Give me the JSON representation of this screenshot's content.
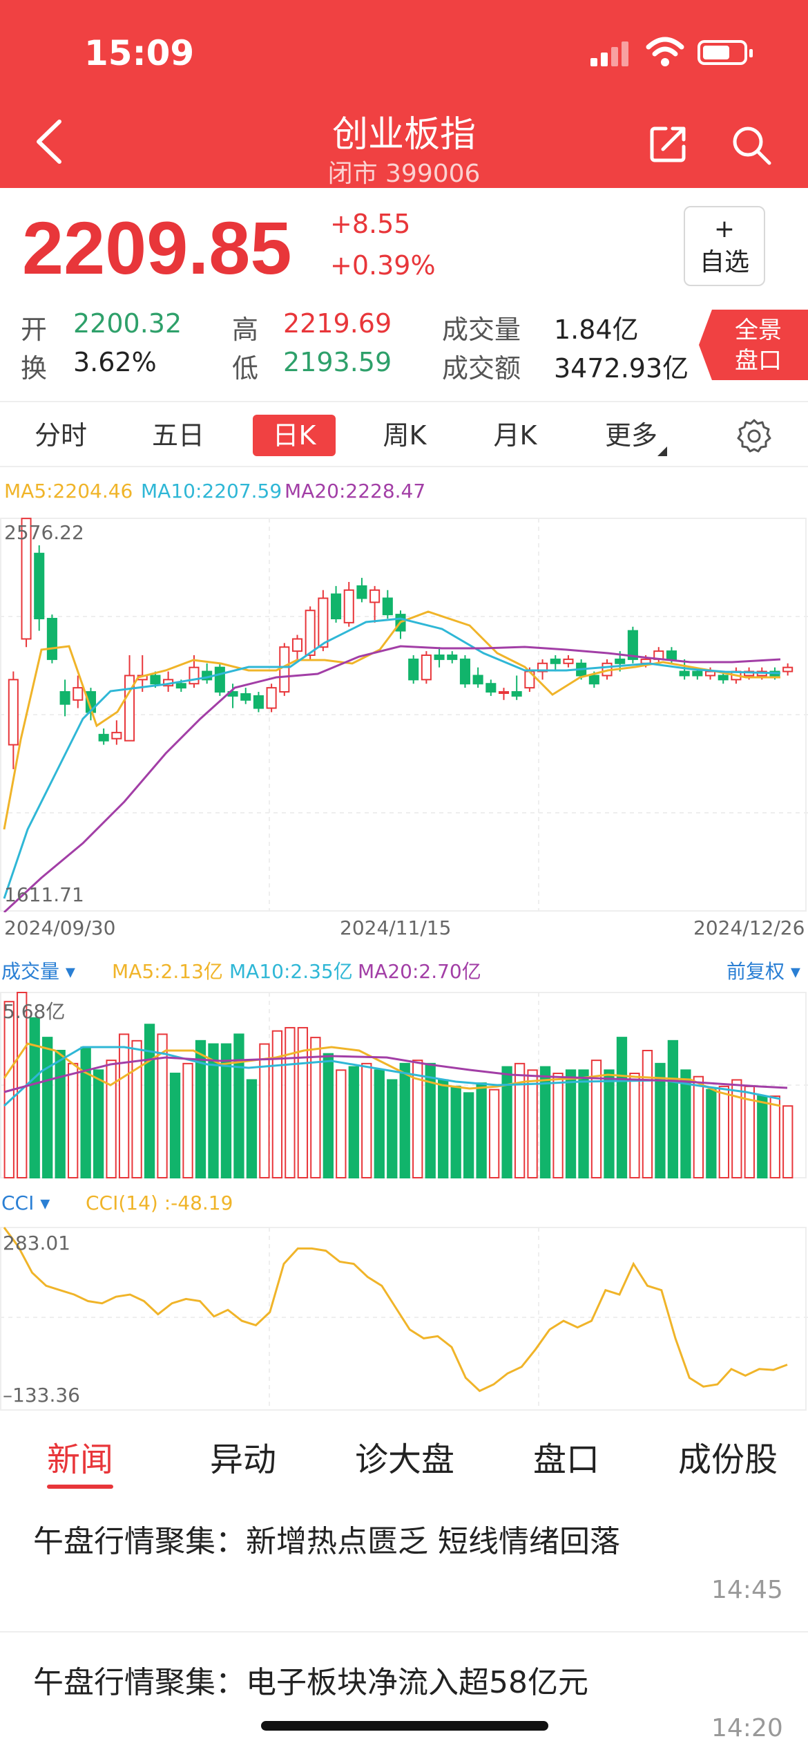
{
  "status_bar": {
    "time": "15:09"
  },
  "header": {
    "title": "创业板指",
    "subtitle": "闭市 399006"
  },
  "quote": {
    "price": "2209.85",
    "change": "+8.55",
    "change_pct": "+0.39%",
    "watch_plus": "+",
    "watch_label": "自选",
    "open_label": "开",
    "open": "2200.32",
    "high_label": "高",
    "high": "2219.69",
    "volume_label": "成交量",
    "volume": "1.84亿",
    "turnover_label": "换",
    "turnover": "3.62%",
    "low_label": "低",
    "low": "2193.59",
    "amount_label": "成交额",
    "amount": "3472.93亿",
    "panorama_line1": "全景",
    "panorama_line2": "盘口"
  },
  "period_tabs": [
    {
      "label": "分时",
      "active": false
    },
    {
      "label": "五日",
      "active": false
    },
    {
      "label": "日K",
      "active": true
    },
    {
      "label": "周K",
      "active": false
    },
    {
      "label": "月K",
      "active": false
    },
    {
      "label": "更多",
      "active": false
    }
  ],
  "kline": {
    "ma5": "MA5:2204.46",
    "ma10": "MA10:2207.59",
    "ma20": "MA20:2228.47",
    "y_max_label": "2576.22",
    "y_min_label": "1611.71",
    "date_start": "2024/09/30",
    "date_mid": "2024/11/15",
    "date_end": "2024/12/26"
  },
  "volume": {
    "title": "成交量",
    "ma5": "MA5:2.13亿",
    "ma10": "MA10:2.35亿",
    "ma20": "MA20:2.70亿",
    "adjust": "前复权",
    "max_label": "5.68亿"
  },
  "cci": {
    "title": "CCI",
    "value": "CCI(14)  :-48.19",
    "max_label": "283.01",
    "min_label": "–133.36"
  },
  "colors": {
    "up": "#e8363a",
    "down": "#11b46b",
    "ma5": "#f0b429",
    "ma10": "#2fb7d6",
    "ma20": "#a23ea6",
    "brand": "#f04142"
  },
  "bottom_tabs": [
    {
      "label": "新闻",
      "active": true
    },
    {
      "label": "异动",
      "active": false
    },
    {
      "label": "诊大盘",
      "active": false
    },
    {
      "label": "盘口",
      "active": false
    },
    {
      "label": "成份股",
      "active": false
    }
  ],
  "news": [
    {
      "title": "午盘行情聚集：新增热点匮乏 短线情绪回落",
      "time": "14:45"
    },
    {
      "title": "午盘行情聚集：电子板块净流入超58亿元",
      "time": "14:20"
    }
  ],
  "chart_data": [
    {
      "type": "candlestick",
      "title": "",
      "ylim": [
        1611.71,
        2576.22
      ],
      "x": [
        "2024/09/30",
        "2024/11/15",
        "2024/12/26"
      ],
      "candles": [
        {
          "o": 2020,
          "c": 2180,
          "h": 2200,
          "l": 1960
        },
        {
          "o": 2280,
          "c": 2576,
          "h": 2576,
          "l": 2260
        },
        {
          "o": 2490,
          "c": 2330,
          "h": 2510,
          "l": 2300
        },
        {
          "o": 2330,
          "c": 2230,
          "h": 2340,
          "l": 2220
        },
        {
          "o": 2150,
          "c": 2120,
          "h": 2180,
          "l": 2090
        },
        {
          "o": 2130,
          "c": 2160,
          "h": 2190,
          "l": 2110
        },
        {
          "o": 2150,
          "c": 2100,
          "h": 2160,
          "l": 2080
        },
        {
          "o": 2045,
          "c": 2030,
          "h": 2060,
          "l": 2020
        },
        {
          "o": 2035,
          "c": 2050,
          "h": 2080,
          "l": 2020
        },
        {
          "o": 2030,
          "c": 2190,
          "h": 2240,
          "l": 2030
        },
        {
          "o": 2180,
          "c": 2190,
          "h": 2240,
          "l": 2150
        },
        {
          "o": 2190,
          "c": 2170,
          "h": 2200,
          "l": 2160
        },
        {
          "o": 2165,
          "c": 2180,
          "h": 2200,
          "l": 2150
        },
        {
          "o": 2170,
          "c": 2160,
          "h": 2180,
          "l": 2150
        },
        {
          "o": 2170,
          "c": 2210,
          "h": 2240,
          "l": 2160
        },
        {
          "o": 2200,
          "c": 2180,
          "h": 2220,
          "l": 2170
        },
        {
          "o": 2210,
          "c": 2150,
          "h": 2220,
          "l": 2140
        },
        {
          "o": 2150,
          "c": 2140,
          "h": 2170,
          "l": 2110
        },
        {
          "o": 2145,
          "c": 2130,
          "h": 2160,
          "l": 2120
        },
        {
          "o": 2140,
          "c": 2110,
          "h": 2150,
          "l": 2100
        },
        {
          "o": 2110,
          "c": 2160,
          "h": 2170,
          "l": 2100
        },
        {
          "o": 2150,
          "c": 2260,
          "h": 2270,
          "l": 2140
        },
        {
          "o": 2250,
          "c": 2280,
          "h": 2290,
          "l": 2230
        },
        {
          "o": 2240,
          "c": 2350,
          "h": 2360,
          "l": 2230
        },
        {
          "o": 2260,
          "c": 2380,
          "h": 2400,
          "l": 2250
        },
        {
          "o": 2390,
          "c": 2330,
          "h": 2410,
          "l": 2320
        },
        {
          "o": 2320,
          "c": 2400,
          "h": 2420,
          "l": 2310
        },
        {
          "o": 2410,
          "c": 2380,
          "h": 2430,
          "l": 2370
        },
        {
          "o": 2370,
          "c": 2400,
          "h": 2410,
          "l": 2320
        },
        {
          "o": 2380,
          "c": 2340,
          "h": 2400,
          "l": 2330
        },
        {
          "o": 2340,
          "c": 2300,
          "h": 2350,
          "l": 2280
        },
        {
          "o": 2230,
          "c": 2180,
          "h": 2240,
          "l": 2170
        },
        {
          "o": 2180,
          "c": 2240,
          "h": 2250,
          "l": 2170
        },
        {
          "o": 2240,
          "c": 2230,
          "h": 2260,
          "l": 2210
        },
        {
          "o": 2240,
          "c": 2230,
          "h": 2250,
          "l": 2220
        },
        {
          "o": 2230,
          "c": 2170,
          "h": 2240,
          "l": 2160
        },
        {
          "o": 2190,
          "c": 2170,
          "h": 2210,
          "l": 2160
        },
        {
          "o": 2170,
          "c": 2150,
          "h": 2180,
          "l": 2140
        },
        {
          "o": 2150,
          "c": 2150,
          "h": 2160,
          "l": 2130
        },
        {
          "o": 2150,
          "c": 2140,
          "h": 2190,
          "l": 2130
        },
        {
          "o": 2160,
          "c": 2200,
          "h": 2210,
          "l": 2150
        },
        {
          "o": 2200,
          "c": 2220,
          "h": 2230,
          "l": 2180
        },
        {
          "o": 2230,
          "c": 2220,
          "h": 2240,
          "l": 2200
        },
        {
          "o": 2220,
          "c": 2230,
          "h": 2240,
          "l": 2210
        },
        {
          "o": 2220,
          "c": 2190,
          "h": 2230,
          "l": 2180
        },
        {
          "o": 2190,
          "c": 2170,
          "h": 2200,
          "l": 2160
        },
        {
          "o": 2190,
          "c": 2220,
          "h": 2230,
          "l": 2180
        },
        {
          "o": 2230,
          "c": 2220,
          "h": 2250,
          "l": 2200
        },
        {
          "o": 2300,
          "c": 2230,
          "h": 2310,
          "l": 2220
        },
        {
          "o": 2220,
          "c": 2230,
          "h": 2240,
          "l": 2210
        },
        {
          "o": 2230,
          "c": 2250,
          "h": 2260,
          "l": 2220
        },
        {
          "o": 2250,
          "c": 2230,
          "h": 2260,
          "l": 2220
        },
        {
          "o": 2200,
          "c": 2190,
          "h": 2230,
          "l": 2180
        },
        {
          "o": 2200,
          "c": 2190,
          "h": 2210,
          "l": 2180
        },
        {
          "o": 2190,
          "c": 2200,
          "h": 2210,
          "l": 2180
        },
        {
          "o": 2190,
          "c": 2180,
          "h": 2200,
          "l": 2170
        },
        {
          "o": 2180,
          "c": 2200,
          "h": 2210,
          "l": 2170
        },
        {
          "o": 2190,
          "c": 2200,
          "h": 2210,
          "l": 2180
        },
        {
          "o": 2190,
          "c": 2200,
          "h": 2210,
          "l": 2180
        },
        {
          "o": 2200,
          "c": 2190,
          "h": 2210,
          "l": 2180
        },
        {
          "o": 2200,
          "c": 2210,
          "h": 2220,
          "l": 2190
        }
      ]
    },
    {
      "type": "bar",
      "title": "",
      "ylim": [
        0,
        5.68
      ],
      "values": [
        5.4,
        5.68,
        4.9,
        4.3,
        3.9,
        3.5,
        4.0,
        3.3,
        3.6,
        4.4,
        4.2,
        4.7,
        4.4,
        3.2,
        3.5,
        4.2,
        4.1,
        4.1,
        4.4,
        3.0,
        4.1,
        4.5,
        4.6,
        4.6,
        4.3,
        3.8,
        3.3,
        3.4,
        3.5,
        3.3,
        3.0,
        3.5,
        3.6,
        3.5,
        3.0,
        2.8,
        2.6,
        2.9,
        2.7,
        3.4,
        3.5,
        3.3,
        3.4,
        3.2,
        3.3,
        3.3,
        3.6,
        3.3,
        4.3,
        3.2,
        3.9,
        3.5,
        4.2,
        3.3,
        3.1,
        2.7,
        2.8,
        3.0,
        2.8,
        2.5,
        2.5,
        2.2
      ]
    },
    {
      "type": "line",
      "title": "",
      "ylim": [
        -133.36,
        283.01
      ],
      "values": [
        283,
        240,
        180,
        150,
        140,
        130,
        115,
        110,
        125,
        130,
        115,
        85,
        110,
        120,
        115,
        80,
        95,
        70,
        60,
        90,
        200,
        235,
        235,
        230,
        205,
        200,
        170,
        150,
        100,
        50,
        30,
        35,
        10,
        -60,
        -90,
        -75,
        -50,
        -35,
        5,
        50,
        70,
        55,
        70,
        140,
        130,
        200,
        150,
        140,
        30,
        -60,
        -80,
        -75,
        -40,
        -55,
        -40,
        -42,
        -30
      ]
    }
  ]
}
